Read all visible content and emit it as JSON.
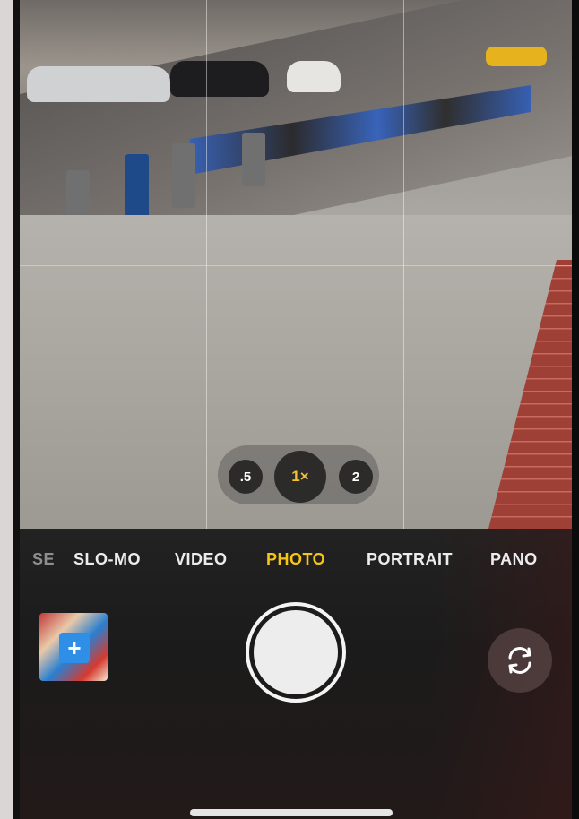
{
  "zoom": {
    "options": [
      ".5",
      "1×",
      "2"
    ],
    "selected": "1×"
  },
  "modes": {
    "items": [
      "SE",
      "SLO-MO",
      "VIDEO",
      "PHOTO",
      "PORTRAIT",
      "PANO"
    ],
    "active": "PHOTO"
  },
  "controls": {
    "thumbnail_icon": "photo-thumbnail-icon",
    "shutter_icon": "shutter-button-icon",
    "flip_icon": "camera-flip-icon"
  },
  "colors": {
    "active_mode": "#f5c518",
    "zoom_selected": "#f2c12e"
  }
}
